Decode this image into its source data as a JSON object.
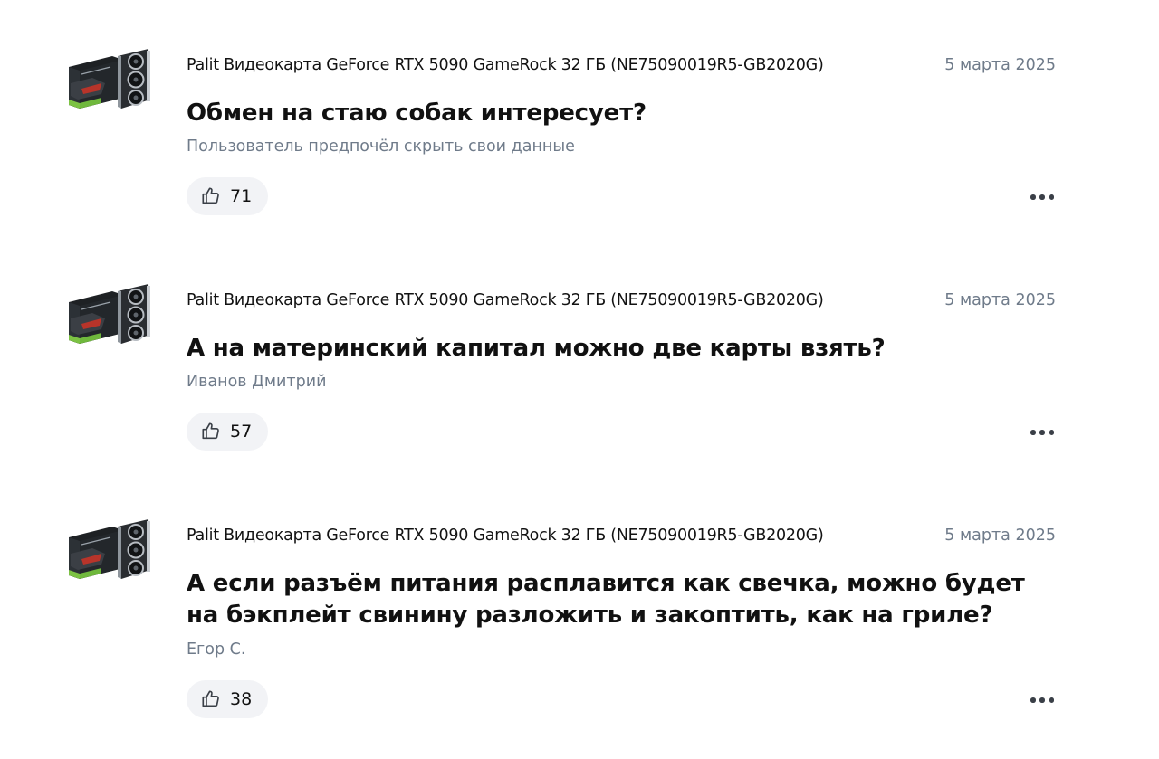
{
  "posts": [
    {
      "product": "Palit Видеокарта GeForce RTX 5090 GameRock 32 ГБ (NE75090019R5-GB2020G)",
      "date": "5 марта 2025",
      "question": "Обмен на стаю собак интересует?",
      "author": "Пользователь предпочёл скрыть свои данные",
      "likes": "71"
    },
    {
      "product": "Palit Видеокарта GeForce RTX 5090 GameRock 32 ГБ (NE75090019R5-GB2020G)",
      "date": "5 марта 2025",
      "question": "А на материнский капитал можно две карты взять?",
      "author": "Иванов Дмитрий",
      "likes": "57"
    },
    {
      "product": "Palit Видеокарта GeForce RTX 5090 GameRock 32 ГБ (NE75090019R5-GB2020G)",
      "date": "5 марта 2025",
      "question": "А если разъём питания расплавится как свечка, можно будет на бэкплейт свинину разложить и закоптить, как на гриле?",
      "author": "Егор С.",
      "likes": "38"
    }
  ],
  "icons": {
    "like": "thumbs-up-icon",
    "more": "more-options-icon",
    "thumbnail": "graphics-card-image"
  },
  "colors": {
    "meta_text": "#6f7b8a",
    "like_pill": "#f2f3f6",
    "text": "#111111"
  }
}
